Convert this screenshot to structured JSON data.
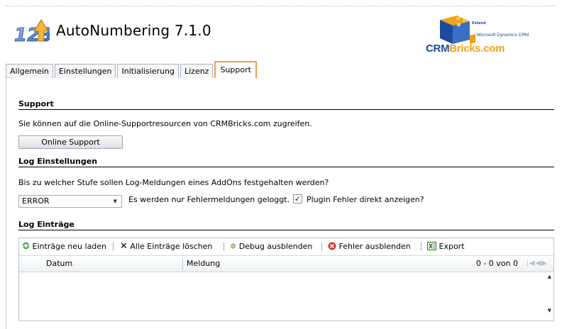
{
  "app": {
    "title": "AutoNumbering 7.1.0"
  },
  "brand": {
    "extend": "Extend",
    "ms_dynamics": "Microsoft Dynamics CRM",
    "crm": "CRM",
    "bricks": "Bricks.com"
  },
  "tabs": [
    {
      "label": "Allgemein",
      "active": false
    },
    {
      "label": "Einstellungen",
      "active": false
    },
    {
      "label": "Initialisierung",
      "active": false
    },
    {
      "label": "Lizenz",
      "active": false
    },
    {
      "label": "Support",
      "active": true
    }
  ],
  "support": {
    "title": "Support",
    "description": "Sie können auf die Online-Supportresourcen von CRMBricks.com zugreifen.",
    "button_label": "Online Support"
  },
  "log_settings": {
    "title": "Log Einstellungen",
    "question": "Bis zu welcher Stufe sollen Log-Meldungen eines AddOns festgehalten werden?",
    "level_selected": "ERROR",
    "level_hint": "Es werden nur Fehlermeldungen geloggt.",
    "show_errors_label": "Plugin Fehler direkt anzeigen?",
    "show_errors_checked": true
  },
  "log_entries": {
    "title": "Log Einträge",
    "toolbar": {
      "reload": "Einträge neu laden",
      "delete_all": "Alle Einträge löschen",
      "hide_debug": "Debug ausblenden",
      "hide_errors": "Fehler ausblenden",
      "export": "Export"
    },
    "columns": [
      "Datum",
      "Meldung"
    ],
    "pager": "0 - 0 von 0",
    "rows": []
  },
  "colors": {
    "active_tab_border": "#f39c4a",
    "brand_blue": "#1b4b9e",
    "brand_orange": "#f0a21a"
  }
}
